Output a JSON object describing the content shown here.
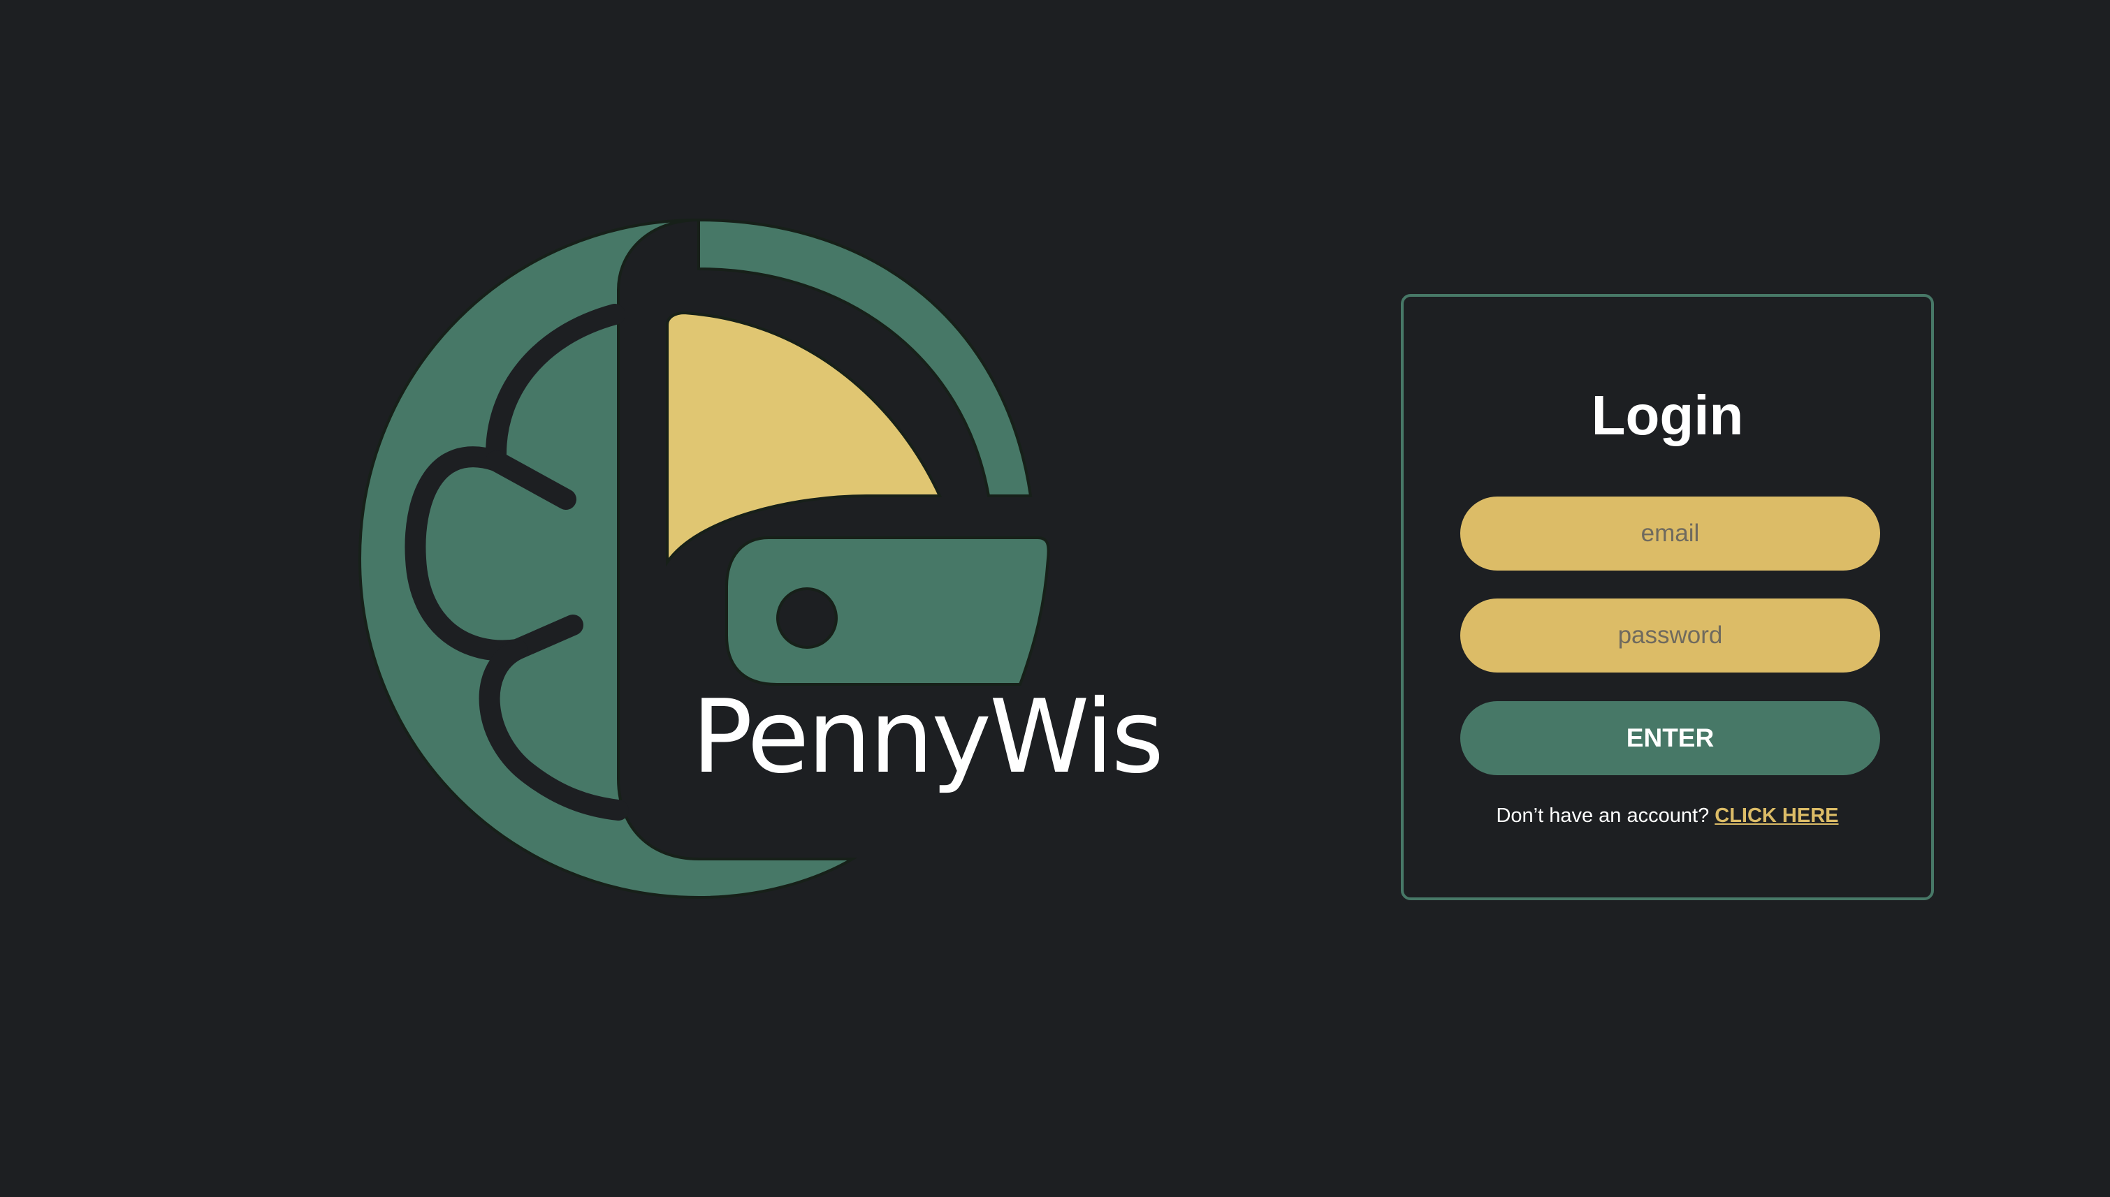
{
  "brand": {
    "name": "PennyWise",
    "colors": {
      "background": "#1d1f22",
      "green": "#477867",
      "gold": "#dcbc67",
      "text": "#ffffff"
    }
  },
  "login": {
    "title": "Login",
    "email_placeholder": "email",
    "password_placeholder": "password",
    "enter_label": "ENTER",
    "signup_prompt": "Don’t have an account?",
    "signup_link_label": "CLICK HERE"
  }
}
